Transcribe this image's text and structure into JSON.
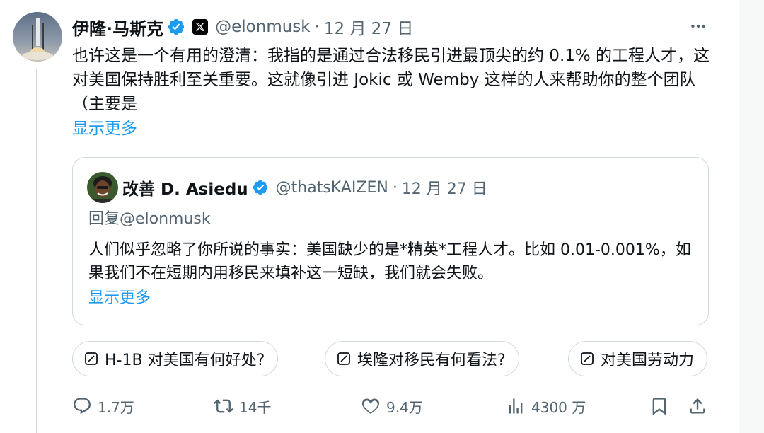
{
  "tweet": {
    "author_name": "伊隆·马斯克",
    "handle": "@elonmusk",
    "separator": "·",
    "date": "12 月 27 日",
    "text": "也许这是一个有用的澄清：我指的是通过合法移民引进最顶尖的约 0.1% 的工程人才，这对美国保持胜利至关重要。这就像引进 Jokic 或 Wemby 这样的人来帮助你的整个团队（主要是",
    "show_more": "显示更多",
    "icons": {
      "verified": "verified-badge-icon",
      "affiliate": "x-logo-icon",
      "more": "more-dots-icon"
    }
  },
  "quote": {
    "author_name": "改善 D. Asiedu",
    "handle": "@thatsKAIZEN",
    "separator": "·",
    "date": "12 月 27 日",
    "reply_to": "回复@elonmusk",
    "text": "人们似乎忽略了你所说的事实：美国缺少的是*精英*工程人才。比如 0.01-0.001%，如果我们不在短期内用移民来填补这一短缺，我们就会失败。",
    "show_more": "显示更多"
  },
  "grok_chips": [
    {
      "label": "H-1B 对美国有何好处?",
      "icon": "grok-icon"
    },
    {
      "label": "埃隆对移民有何看法?",
      "icon": "grok-icon"
    },
    {
      "label": "对美国劳动力",
      "icon": "grok-icon"
    }
  ],
  "actions": {
    "reply_count": "1.7万",
    "retweet_count": "14千",
    "like_count": "9.4万",
    "views_count": "4300 万",
    "icons": [
      "reply-icon",
      "retweet-icon",
      "like-icon",
      "views-icon",
      "bookmark-icon",
      "share-icon"
    ]
  },
  "colors": {
    "accent": "#1d9bf0",
    "secondary_text": "#536471",
    "border": "#cfd9de",
    "text": "#0f1419"
  }
}
